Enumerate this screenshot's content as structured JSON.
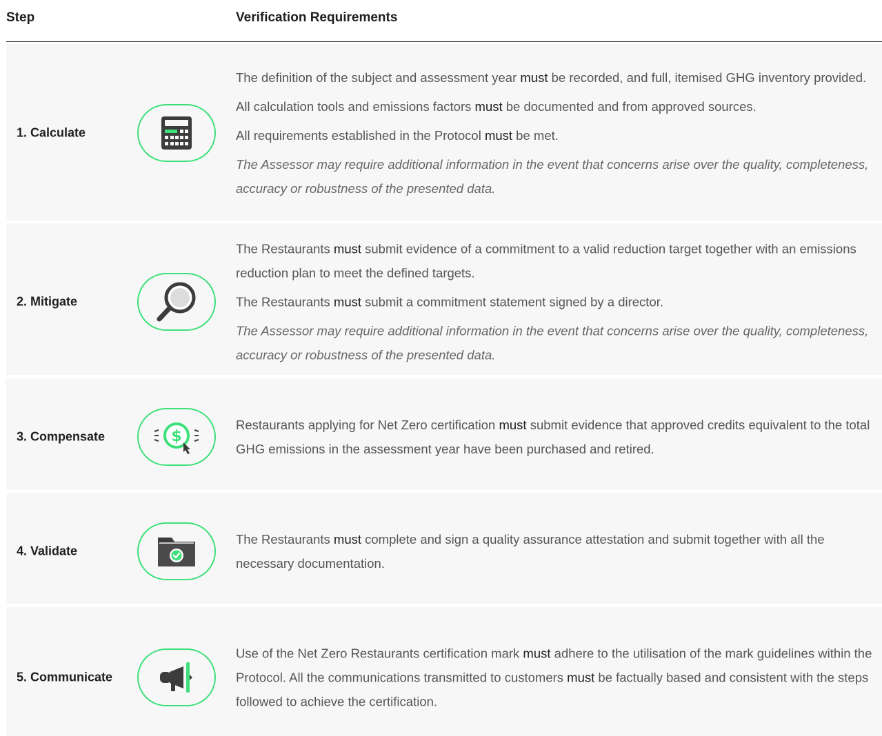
{
  "header": {
    "step": "Step",
    "requirements": "Verification Requirements"
  },
  "rows": [
    {
      "label": "1. Calculate",
      "icon": "calculator-icon",
      "paragraphs": [
        {
          "before": "The definition of the subject and assessment year ",
          "must": "must",
          "after": " be recorded, and full, itemised GHG inventory provided."
        },
        {
          "before": "All calculation tools and emissions factors ",
          "must": "must",
          "after": " be documented and from approved sources."
        },
        {
          "before": "All requirements established in the Protocol ",
          "must": "must",
          "after": " be met."
        }
      ],
      "note": "The Assessor may require additional information in the event that concerns arise over the quality, completeness, accuracy or robustness of the presented data."
    },
    {
      "label": "2. Mitigate",
      "icon": "magnifier-icon",
      "paragraphs": [
        {
          "before": "The Restaurants ",
          "must": "must",
          "after": " submit evidence of a commitment to a valid reduction target together with an emissions reduction plan to meet the defined targets."
        },
        {
          "before": "The Restaurants ",
          "must": "must",
          "after": " submit a commitment statement signed by a director."
        }
      ],
      "note": "The Assessor may require additional information in the event that concerns arise over the quality, completeness, accuracy or robustness of the presented data."
    },
    {
      "label": "3. Compensate",
      "icon": "dollar-click-icon",
      "paragraphs": [
        {
          "before": "Restaurants applying for Net Zero certification ",
          "must": "must",
          "after": " submit evidence that approved credits equivalent to the total GHG emissions in the assessment year have been purchased and retired."
        }
      ]
    },
    {
      "label": "4. Validate",
      "icon": "folder-check-icon",
      "paragraphs": [
        {
          "before": "The Restaurants ",
          "must": "must",
          "after": " complete and sign a quality assurance attestation and submit together with all the necessary documentation."
        }
      ]
    },
    {
      "label": "5. Communicate",
      "icon": "megaphone-icon",
      "paragraphs": [
        {
          "before": "Use of the Net Zero Restaurants certification mark ",
          "must": "must",
          "after": " adhere to the utilisation of the mark guidelines within the Protocol. All the communications transmitted to customers "
        },
        {
          "before": "",
          "must": "must",
          "after": " be factually based and consistent with the steps followed to achieve the certification."
        }
      ],
      "merge_paragraphs": true
    }
  ],
  "colors": {
    "accent": "#3ee07a",
    "row_background": "#f7f7f7",
    "icon_dark": "#3c3c3c"
  }
}
